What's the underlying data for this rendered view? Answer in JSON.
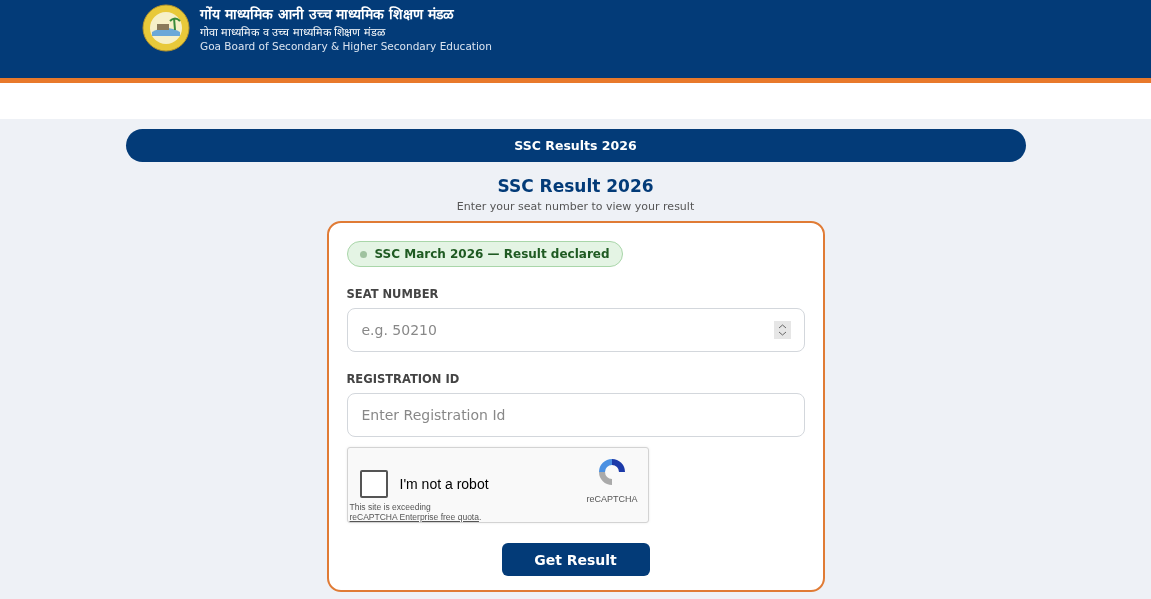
{
  "header": {
    "title": "गोंय माध्यमिक आनी उच्च माध्यमिक शिक्षण मंडळ",
    "subtitle": "गोवा माध्यमिक व उच्च माध्यमिक शिक्षण मंडळ",
    "english_name": "Goa Board of Secondary & Higher Secondary Education"
  },
  "banner": "SSC Results 2026",
  "heading": "SSC Result 2026",
  "subheading": "Enter your seat number to view your result",
  "status_badge": {
    "text": "SSC March 2026 — Result declared"
  },
  "fields": [
    {
      "kind": "number",
      "label": "SEAT NUMBER",
      "placeholder": "e.g. 50210"
    },
    {
      "kind": "text",
      "label": "REGISTRATION ID",
      "placeholder": "Enter Registration Id"
    }
  ],
  "captcha": {
    "label": "I'm not a robot",
    "checked": false,
    "brand": "reCAPTCHA",
    "notice": "This site is exceeding",
    "notice_link": "reCAPTCHA Enterprise free quota",
    "notice_end": "."
  },
  "submit": "Get Result"
}
